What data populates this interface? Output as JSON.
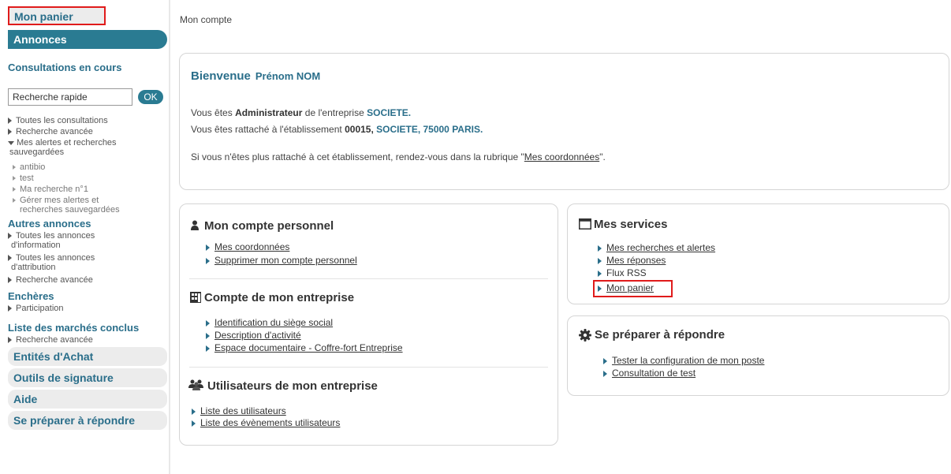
{
  "sidebar": {
    "mon_panier": "Mon panier",
    "annonces": "Annonces",
    "consultations_title": "Consultations en cours",
    "search_value": "Recherche rapide",
    "ok_label": "OK",
    "items": [
      "Toutes les consultations",
      "Recherche avancée"
    ],
    "alerts": {
      "label_line1": "Mes alertes et recherches",
      "label_line2": "sauvegardées",
      "subitems": [
        "antibio",
        "test",
        "Ma recherche n°1"
      ],
      "manage_line1": "Gérer mes alertes et",
      "manage_line2": "recherches sauvegardées"
    },
    "autres_title": "Autres annonces",
    "autres_items": [
      {
        "line1": "Toutes les annonces",
        "line2": "d'information"
      },
      {
        "line1": "Toutes les annonces",
        "line2": "d'attribution"
      }
    ],
    "autres_recherche": "Recherche avancée",
    "encheres_title": "Enchères",
    "encheres_item": "Participation",
    "marches_title": "Liste des marchés conclus",
    "marches_item": "Recherche avancée",
    "bottom": [
      "Entités d'Achat",
      "Outils de signature",
      "Aide",
      "Se préparer à répondre"
    ]
  },
  "breadcrumb": "Mon compte",
  "welcome": {
    "title": "Bienvenue",
    "name": "Prénom NOM",
    "line1_pre": "Vous êtes",
    "line1_role": "Administrateur",
    "line1_mid": "de l'entreprise",
    "line1_company": "SOCIETE.",
    "line2_pre": "Vous êtes rattaché à l'établissement",
    "line2_code": "00015,",
    "line2_addr": "SOCIETE, 75000 PARIS.",
    "line3_pre": "Si vous n'êtes plus rattaché à cet établissement, rendez-vous dans la rubrique \"",
    "line3_link": "Mes coordonnées",
    "line3_post": "\"."
  },
  "compte_perso": {
    "title": "Mon compte personnel",
    "links": [
      "Mes coordonnées",
      "Supprimer mon compte personnel"
    ]
  },
  "compte_entreprise": {
    "title": "Compte de mon entreprise",
    "links": [
      "Identification du siège social",
      "Description d'activité",
      "Espace documentaire - Coffre-fort Entreprise"
    ]
  },
  "utilisateurs": {
    "title": "Utilisateurs de mon entreprise",
    "links": [
      "Liste des utilisateurs",
      "Liste des évènements utilisateurs"
    ]
  },
  "services": {
    "title": "Mes services",
    "links": [
      "Mes recherches et alertes",
      "Mes réponses"
    ],
    "rss": "Flux RSS",
    "panier": "Mon panier"
  },
  "preparer": {
    "title": "Se préparer à répondre",
    "links": [
      "Tester la configuration de mon poste",
      "Consultation de test"
    ]
  },
  "colors": {
    "accent": "#2a6e8a",
    "highlight": "#e01b1b"
  },
  "icons": [
    "person-icon",
    "building-icon",
    "users-icon",
    "window-icon",
    "gear-icon",
    "triangle-bullet-icon"
  ]
}
